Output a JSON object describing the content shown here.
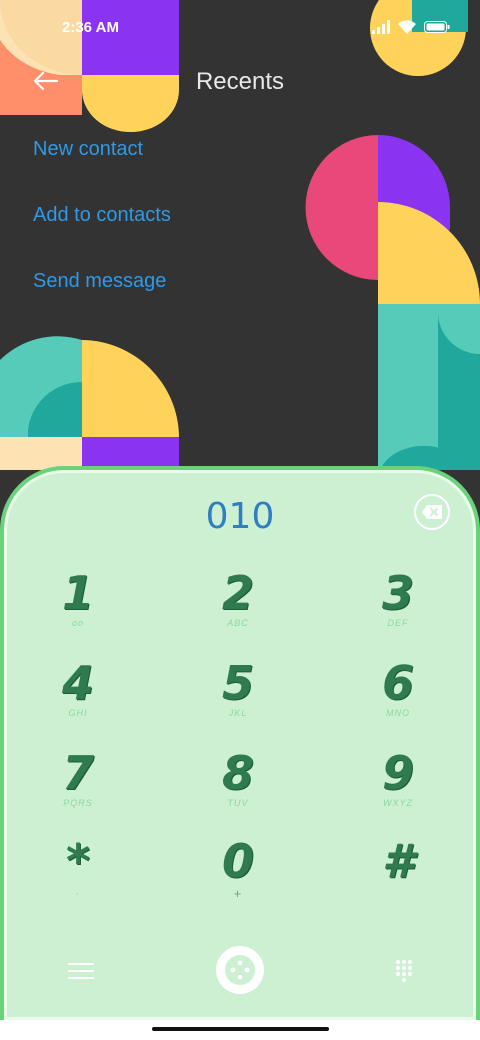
{
  "status_bar": {
    "time": "2:36 AM",
    "icons": [
      "signal-icon",
      "wifi-icon",
      "battery-icon"
    ]
  },
  "header": {
    "back_icon": "back-arrow-icon",
    "title": "Recents"
  },
  "actions": [
    {
      "label": "New contact"
    },
    {
      "label": "Add to contacts"
    },
    {
      "label": "Send message"
    }
  ],
  "dialer": {
    "number": "010",
    "backspace_icon": "backspace-icon",
    "keys": [
      {
        "digit": "1",
        "sub": "oo"
      },
      {
        "digit": "2",
        "sub": "ABC"
      },
      {
        "digit": "3",
        "sub": "DEF"
      },
      {
        "digit": "4",
        "sub": "GHI"
      },
      {
        "digit": "5",
        "sub": "JKL"
      },
      {
        "digit": "6",
        "sub": "MNO"
      },
      {
        "digit": "7",
        "sub": "PQRS"
      },
      {
        "digit": "8",
        "sub": "TUV"
      },
      {
        "digit": "9",
        "sub": "WXYZ"
      },
      {
        "digit": "*",
        "sub": ","
      },
      {
        "digit": "0",
        "sub": "+"
      },
      {
        "digit": "#",
        "sub": ""
      }
    ],
    "menu_icon": "menu-icon",
    "call_icon": "call-icon",
    "keypad_icon": "keypad-icon"
  },
  "colors": {
    "background": "#333333",
    "link": "#2e9ae8",
    "dialer_bg": "#cdf0d2",
    "dialer_border": "#6ad27a",
    "digit": "#2f7a4e",
    "number": "#2f7fc0"
  }
}
